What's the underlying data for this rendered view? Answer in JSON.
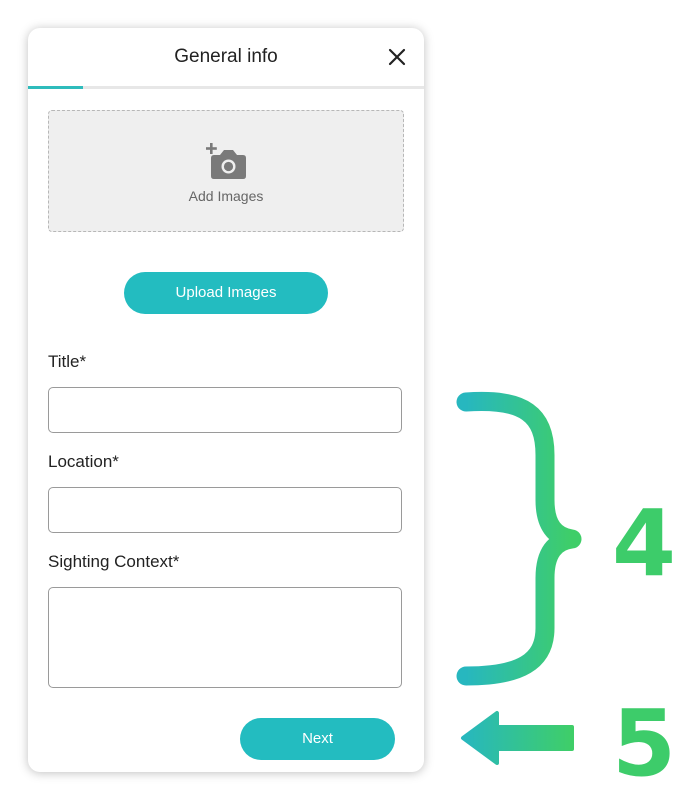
{
  "header": {
    "title": "General info",
    "close_icon": "close-icon",
    "progress_fraction": 0.14
  },
  "image_upload": {
    "dropzone_label": "Add Images",
    "dropzone_icon": "add-camera-icon",
    "upload_button": "Upload Images"
  },
  "form": {
    "title_label": "Title*",
    "title_value": "",
    "location_label": "Location*",
    "location_value": "",
    "context_label": "Sighting Context*",
    "context_value": ""
  },
  "footer": {
    "next_button": "Next"
  },
  "annotations": {
    "bracket_step": "4",
    "arrow_step": "5",
    "gradient_start": "#27b7bf",
    "gradient_end": "#3fce68"
  },
  "colors": {
    "accent": "#23bcc0",
    "annotation_green": "#3dcc6a"
  }
}
